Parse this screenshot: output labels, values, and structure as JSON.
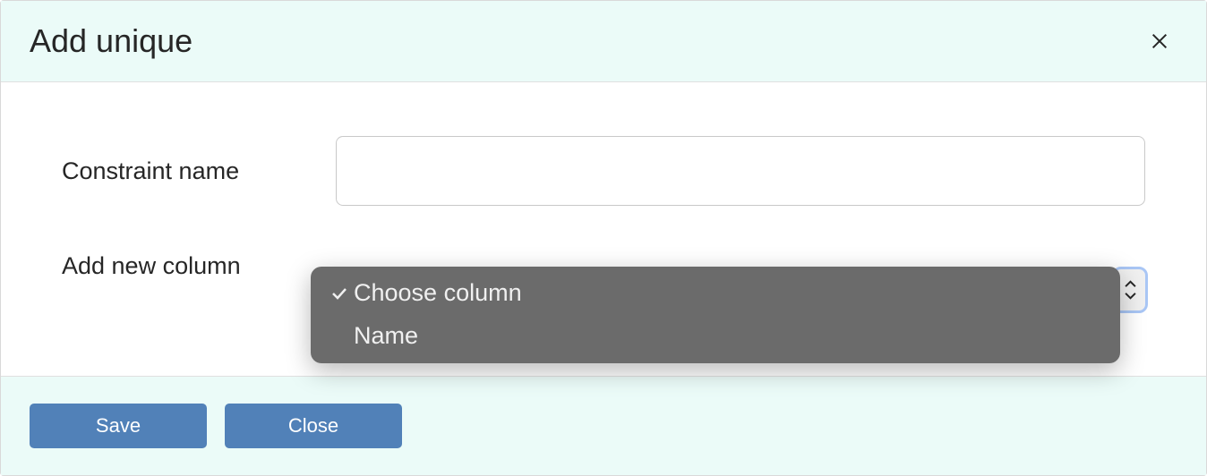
{
  "dialog": {
    "title": "Add unique"
  },
  "form": {
    "constraint_name_label": "Constraint name",
    "constraint_name_value": "",
    "add_column_label": "Add new column"
  },
  "dropdown": {
    "options": [
      {
        "label": "Choose column",
        "selected": true
      },
      {
        "label": "Name",
        "selected": false
      }
    ]
  },
  "footer": {
    "save_label": "Save",
    "close_label": "Close"
  }
}
